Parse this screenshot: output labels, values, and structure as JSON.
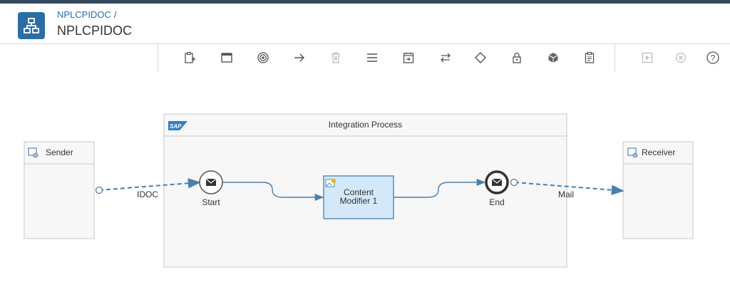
{
  "header": {
    "breadcrumb": "NPLCPIDOC",
    "breadcrumb_sep": "/",
    "title": "NPLCPIDOC",
    "accent_color": "#2b6ea6",
    "app_icon": "hierarchy-icon"
  },
  "toolbar": {
    "buttons": [
      "clipboard-add-icon",
      "window-icon",
      "target-icon",
      "arrow-right-icon",
      "delete-icon",
      "menu-icon",
      "calendar-icon",
      "exchange-icon",
      "gateway-icon",
      "lock-icon",
      "cube-icon",
      "clipboard-icon",
      "run-icon",
      "cancel-icon",
      "help-icon"
    ]
  },
  "diagram": {
    "process_title": "Integration Process",
    "process_logo": "SAP",
    "sender": "Sender",
    "receiver": "Receiver",
    "start_label": "Start",
    "end_label": "End",
    "step_line1": "Content",
    "step_line2": "Modifier 1",
    "sender_adapter": "IDOC",
    "receiver_adapter": "Mail"
  }
}
